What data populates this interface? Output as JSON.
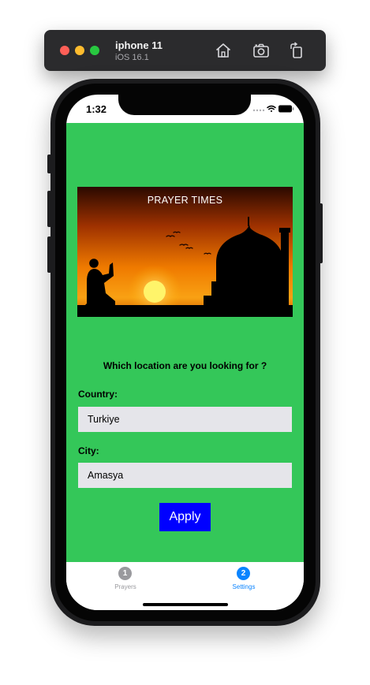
{
  "simulator": {
    "device_name": "iphone 11",
    "os_version": "iOS 16.1",
    "icons": [
      "home-icon",
      "screenshot-icon",
      "rotate-icon"
    ]
  },
  "status_bar": {
    "time": "1:32",
    "icons": [
      "signal-dots-icon",
      "wifi-icon",
      "battery-icon"
    ]
  },
  "banner": {
    "title": "PRAYER TIMES"
  },
  "form": {
    "question": "Which location are you looking for ?",
    "country_label": "Country:",
    "country_value": "Turkiye",
    "city_label": "City:",
    "city_value": "Amasya",
    "apply_label": "Apply"
  },
  "tab_bar": {
    "tabs": [
      {
        "badge": "1",
        "label": "Prayers",
        "selected": false
      },
      {
        "badge": "2",
        "label": "Settings",
        "selected": true
      }
    ]
  },
  "colors": {
    "background_green": "#34c759",
    "apply_blue": "#0000ff",
    "field_gray": "#e5e5ea",
    "tab_selected": "#0a84ff",
    "tab_unselected": "#9a9a9e"
  }
}
